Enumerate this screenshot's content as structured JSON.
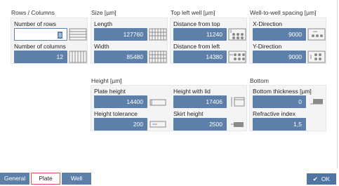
{
  "groups": {
    "rows_columns": {
      "title": "Rows / Columns",
      "number_of_rows_label": "Number of rows",
      "number_of_rows_value": "8",
      "number_of_columns_label": "Number of columns",
      "number_of_columns_value": "12"
    },
    "size": {
      "title": "Size [µm]",
      "length_label": "Length",
      "length_value": "127760",
      "width_label": "Width",
      "width_value": "85480"
    },
    "top_left_well": {
      "title": "Top left well [µm]",
      "distance_top_label": "Distance from top",
      "distance_top_value": "11240",
      "distance_left_label": "Distance from left",
      "distance_left_value": "14380"
    },
    "spacing": {
      "title": "Well-to-well spacing [µm]",
      "x_label": "X-Direction",
      "x_value": "9000",
      "y_label": "Y-Direction",
      "y_value": "9000"
    },
    "height": {
      "title": "Height [µm]",
      "plate_height_label": "Plate height",
      "plate_height_value": "14400",
      "height_with_lid_label": "Height with lid",
      "height_with_lid_value": "17406",
      "height_tolerance_label": "Height tolerance",
      "height_tolerance_value": "200",
      "skirt_height_label": "Skirt height",
      "skirt_height_value": "2500"
    },
    "bottom": {
      "title": "Bottom",
      "thickness_label": "Bottom thickness [µm]",
      "thickness_value": "0",
      "refractive_label": "Refractive index",
      "refractive_value": "1,5"
    }
  },
  "tabs": [
    "General",
    "Plate",
    "Well"
  ],
  "ok_label": "OK",
  "colors": {
    "field_bg": "#5c80a8",
    "tab_bg": "#5c80a8",
    "selected_tab_border": "#d9534f",
    "panel_bg": "#f4f4f4"
  },
  "icons": [
    "rows-grid-icon",
    "columns-grid-icon",
    "length-grid-icon",
    "width-grid-icon",
    "distance-top-icon",
    "distance-left-icon",
    "x-spacing-icon",
    "y-spacing-icon",
    "plate-height-icon",
    "height-with-lid-icon",
    "height-tolerance-icon",
    "skirt-height-icon",
    "bottom-thickness-icon"
  ]
}
